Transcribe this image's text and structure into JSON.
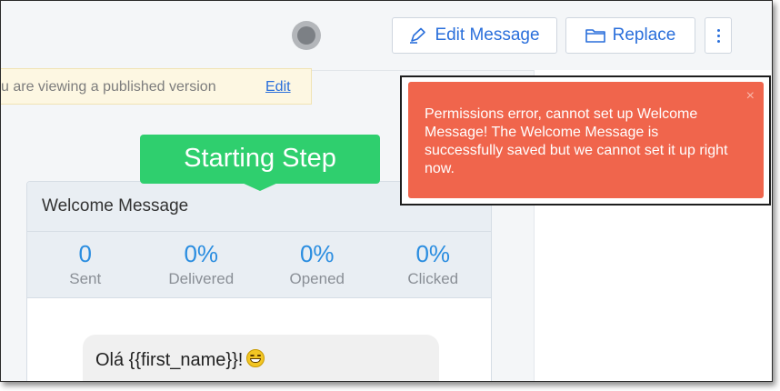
{
  "toolbar": {
    "edit_label": "Edit Message",
    "replace_label": "Replace"
  },
  "notice": {
    "text": "u are viewing a published version",
    "link": "Edit"
  },
  "step": {
    "banner": "Starting Step"
  },
  "card": {
    "title": "Welcome Message",
    "stats": [
      {
        "value": "0",
        "label": "Sent"
      },
      {
        "value": "0%",
        "label": "Delivered"
      },
      {
        "value": "0%",
        "label": "Opened"
      },
      {
        "value": "0%",
        "label": "Clicked"
      }
    ],
    "message_preview": "Olá {{first_name}}!"
  },
  "toast": {
    "message": "Permissions error, cannot set up Welcome Message! The Welcome Message is successfully saved but we cannot set it up right now.",
    "close": "×"
  },
  "colors": {
    "accent": "#2a6fdb",
    "success": "#2fcf6e",
    "error": "#f0654c",
    "stat_value": "#2a8de0"
  },
  "icons": {
    "edit": "pen-icon",
    "replace": "folder-icon",
    "more": "kebab-menu-icon",
    "emoji": "grinning-face-icon"
  }
}
